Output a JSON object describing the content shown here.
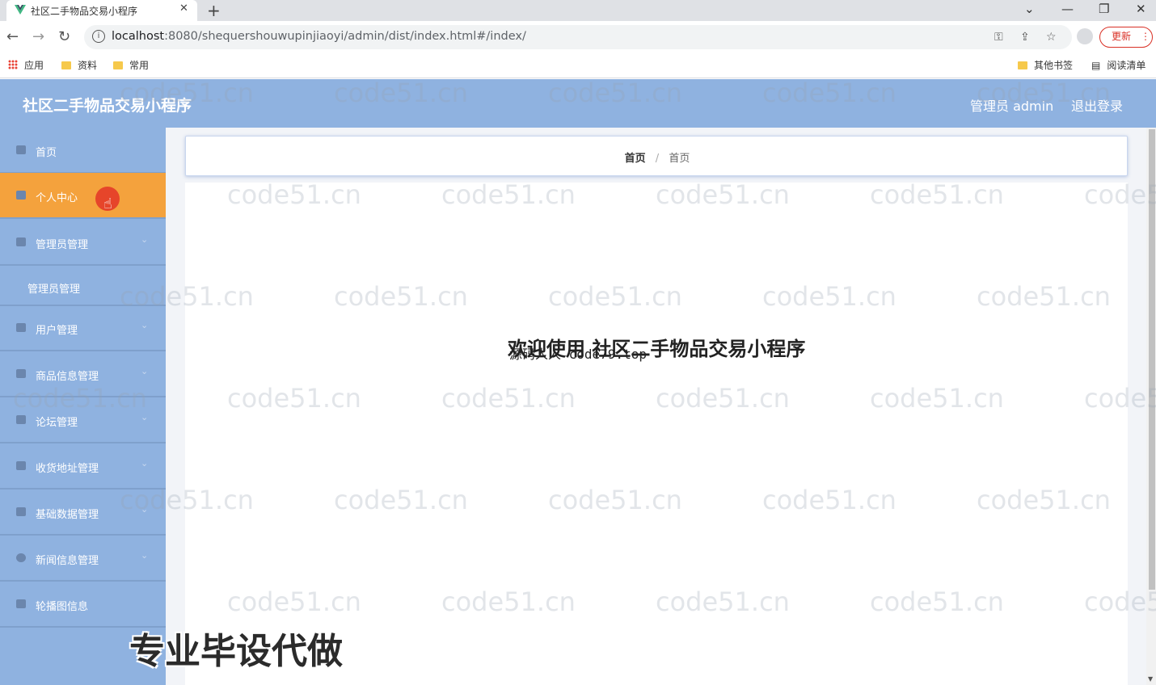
{
  "browser": {
    "tab_title": "社区二手物品交易小程序",
    "url_host": "localhost",
    "url_rest": ":8080/shequershouwupinjiaoyi/admin/dist/index.html#/index/",
    "update_label": "更新",
    "bookmarks": {
      "apps": "应用",
      "materials": "资料",
      "common": "常用",
      "other": "其他书签",
      "reading_list": "阅读清单"
    }
  },
  "header": {
    "title": "社区二手物品交易小程序",
    "user_label": "管理员 admin",
    "logout_label": "退出登录"
  },
  "sidebar": {
    "items": [
      {
        "label": "首页"
      },
      {
        "label": "个人中心"
      },
      {
        "label": "管理员管理"
      },
      {
        "label": "管理员管理"
      },
      {
        "label": "用户管理"
      },
      {
        "label": "商品信息管理"
      },
      {
        "label": "论坛管理"
      },
      {
        "label": "收货地址管理"
      },
      {
        "label": "基础数据管理"
      },
      {
        "label": "新闻信息管理"
      },
      {
        "label": "轮播图信息"
      }
    ]
  },
  "breadcrumb": {
    "first": "首页",
    "separator": "/",
    "second": "首页"
  },
  "main": {
    "welcome": "欢迎使用 社区二手物品交易小程序",
    "overlay": "源码人人 code79.top"
  },
  "promo": "专业毕设代做",
  "watermark": "code51.cn",
  "colors": {
    "header_bg": "#8fb2e0",
    "active_item": "#f4a23d"
  }
}
